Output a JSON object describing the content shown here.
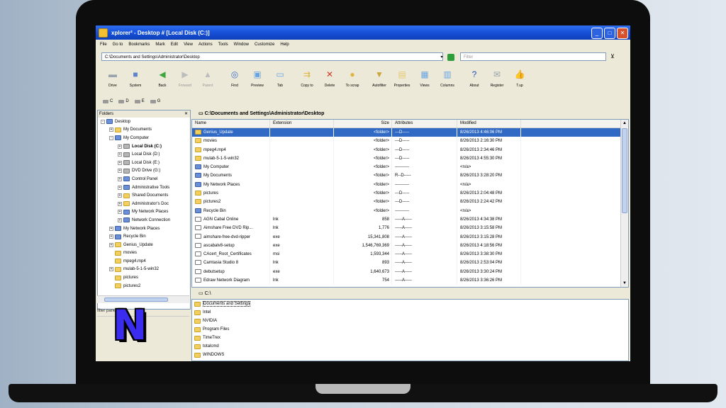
{
  "window": {
    "title": "xplorer² - Desktop # [Local Disk (C:)]",
    "buttons": [
      "_",
      "□",
      "✕"
    ]
  },
  "menu": [
    "File",
    "Go to",
    "Bookmarks",
    "Mark",
    "Edit",
    "View",
    "Actions",
    "Tools",
    "Window",
    "Customize",
    "Help"
  ],
  "address": {
    "value": "C:\\Documents and Settings\\Administrator\\Desktop",
    "filter_placeholder": "Filter"
  },
  "toolbar": [
    {
      "label": "Drive",
      "icon": "drive-icon",
      "glyph": "▬",
      "color": "#9aa3ad",
      "disabled": false
    },
    {
      "label": "System",
      "icon": "system-icon",
      "glyph": "■",
      "color": "#5f83c9",
      "disabled": false
    },
    {
      "sep": true
    },
    {
      "label": "Back",
      "icon": "back-arrow-icon",
      "glyph": "◀",
      "color": "#3fa63f",
      "disabled": false
    },
    {
      "label": "Forward",
      "icon": "forward-arrow-icon",
      "glyph": "▶",
      "color": "#bdbdbd",
      "disabled": true
    },
    {
      "label": "Parent",
      "icon": "parent-folder-icon",
      "glyph": "▲",
      "color": "#bdbdbd",
      "disabled": true
    },
    {
      "sep": true
    },
    {
      "label": "Find",
      "icon": "binoculars-icon",
      "glyph": "◎",
      "color": "#3b6fc9",
      "disabled": false
    },
    {
      "label": "Preview",
      "icon": "preview-icon",
      "glyph": "▣",
      "color": "#6aa4e0",
      "disabled": false
    },
    {
      "label": "Tab",
      "icon": "tab-icon",
      "glyph": "▭",
      "color": "#6aa4e0",
      "disabled": false
    },
    {
      "sep": true
    },
    {
      "label": "Copy to",
      "icon": "copy-to-icon",
      "glyph": "⇉",
      "color": "#e0b53b",
      "disabled": false
    },
    {
      "label": "Delete",
      "icon": "delete-icon",
      "glyph": "✕",
      "color": "#d23a2a",
      "disabled": false
    },
    {
      "label": "To scrap",
      "icon": "scrap-icon",
      "glyph": "●",
      "color": "#e0b53b",
      "disabled": false
    },
    {
      "sep": true
    },
    {
      "label": "Autofilter",
      "icon": "autofilter-icon",
      "glyph": "▼",
      "color": "#c9a53b",
      "disabled": false
    },
    {
      "label": "Properties",
      "icon": "properties-icon",
      "glyph": "▤",
      "color": "#e6c870",
      "disabled": false
    },
    {
      "label": "Views",
      "icon": "views-icon",
      "glyph": "▦",
      "color": "#6aa4e0",
      "disabled": false
    },
    {
      "label": "Columns",
      "icon": "columns-icon",
      "glyph": "▥",
      "color": "#6aa4e0",
      "disabled": false
    },
    {
      "sep": true
    },
    {
      "label": "About",
      "icon": "help-icon",
      "glyph": "?",
      "color": "#1f4fb5",
      "disabled": false
    },
    {
      "label": "Register",
      "icon": "register-icon",
      "glyph": "✉",
      "color": "#9aa3ad",
      "disabled": false
    },
    {
      "label": "T.up",
      "icon": "thumbs-up-icon",
      "glyph": "👍",
      "color": "#e0b53b",
      "disabled": false
    }
  ],
  "drives": [
    "C",
    "D",
    "E",
    "G"
  ],
  "folders_pane": {
    "title": "Folders",
    "tree": [
      {
        "label": "Desktop",
        "indent": 0,
        "exp": "-",
        "type": "sys"
      },
      {
        "label": "My Documents",
        "indent": 1,
        "exp": "+",
        "type": "folder"
      },
      {
        "label": "My Computer",
        "indent": 1,
        "exp": "-",
        "type": "sys"
      },
      {
        "label": "Local Disk (C:)",
        "indent": 2,
        "exp": "+",
        "type": "drive",
        "selected": true
      },
      {
        "label": "Local Disk (D:)",
        "indent": 2,
        "exp": "+",
        "type": "drive"
      },
      {
        "label": "Local Disk (E:)",
        "indent": 2,
        "exp": "+",
        "type": "drive"
      },
      {
        "label": "DVD Drive (G:)",
        "indent": 2,
        "exp": "+",
        "type": "drive"
      },
      {
        "label": "Control Panel",
        "indent": 2,
        "exp": "+",
        "type": "sys"
      },
      {
        "label": "Administrative Tools",
        "indent": 2,
        "exp": "+",
        "type": "sys"
      },
      {
        "label": "Shared Documents",
        "indent": 2,
        "exp": "+",
        "type": "folder"
      },
      {
        "label": "Administrator's Doc",
        "indent": 2,
        "exp": "+",
        "type": "folder"
      },
      {
        "label": "My Network Places",
        "indent": 2,
        "exp": "+",
        "type": "sys"
      },
      {
        "label": "Network Connection",
        "indent": 2,
        "exp": "+",
        "type": "sys"
      },
      {
        "label": "My Network Places",
        "indent": 1,
        "exp": "+",
        "type": "sys"
      },
      {
        "label": "Recycle Bin",
        "indent": 1,
        "exp": "+",
        "type": "sys"
      },
      {
        "label": "Genius_Update",
        "indent": 1,
        "exp": "+",
        "type": "folder"
      },
      {
        "label": "movies",
        "indent": 1,
        "exp": "",
        "type": "folder"
      },
      {
        "label": "mpeg4.mp4",
        "indent": 1,
        "exp": "",
        "type": "folder"
      },
      {
        "label": "mulab-5-1-5-win32",
        "indent": 1,
        "exp": "+",
        "type": "folder"
      },
      {
        "label": "pictures",
        "indent": 1,
        "exp": "",
        "type": "folder"
      },
      {
        "label": "pictures2",
        "indent": 1,
        "exp": "",
        "type": "folder"
      }
    ],
    "lower_label": "filter pane"
  },
  "list": {
    "path": "C:\\Documents and Settings\\Administrator\\Desktop",
    "columns": [
      "Name",
      "Extension",
      "Size",
      "Attributes",
      "Modified"
    ],
    "rows": [
      {
        "name": "Genius_Update",
        "ext": "",
        "size": "<folder>",
        "attr": "---D-----",
        "mod": "8/26/2013 4:46:06 PM",
        "type": "folder",
        "selected": true
      },
      {
        "name": "movies",
        "ext": "",
        "size": "<folder>",
        "attr": "---D-----",
        "mod": "8/26/2013 2:16:30 PM",
        "type": "folder"
      },
      {
        "name": "mpeg4.mp4",
        "ext": "",
        "size": "<folder>",
        "attr": "---D-----",
        "mod": "8/26/2013 2:34:46 PM",
        "type": "folder"
      },
      {
        "name": "mulab-5-1-5-win32",
        "ext": "",
        "size": "<folder>",
        "attr": "---D-----",
        "mod": "8/26/2013 4:55:30 PM",
        "type": "folder"
      },
      {
        "name": "My Computer",
        "ext": "",
        "size": "<folder>",
        "attr": "----------",
        "mod": "<n/a>",
        "type": "sys"
      },
      {
        "name": "My Documents",
        "ext": "",
        "size": "<folder>",
        "attr": "R--D-----",
        "mod": "8/26/2013 3:28:20 PM",
        "type": "sys"
      },
      {
        "name": "My Network Places",
        "ext": "",
        "size": "<folder>",
        "attr": "----------",
        "mod": "<n/a>",
        "type": "sys"
      },
      {
        "name": "pictures",
        "ext": "",
        "size": "<folder>",
        "attr": "---D-----",
        "mod": "8/26/2013 2:04:48 PM",
        "type": "folder"
      },
      {
        "name": "pictures2",
        "ext": "",
        "size": "<folder>",
        "attr": "---D-----",
        "mod": "8/26/2013 2:24:42 PM",
        "type": "folder"
      },
      {
        "name": "Recycle Bin",
        "ext": "",
        "size": "<folder>",
        "attr": "----------",
        "mod": "<n/a>",
        "type": "sys"
      },
      {
        "name": "AGN Cabal Online",
        "ext": "lnk",
        "size": "858",
        "attr": "-----A-----",
        "mod": "8/26/2013 4:34:38 PM",
        "type": "file"
      },
      {
        "name": "Aimshare Free DVD Rip...",
        "ext": "lnk",
        "size": "1,776",
        "attr": "-----A-----",
        "mod": "8/26/2013 3:15:58 PM",
        "type": "file"
      },
      {
        "name": "aimshare-free-dvd-ripper",
        "ext": "exe",
        "size": "15,341,808",
        "attr": "-----A-----",
        "mod": "8/26/2013 3:15:28 PM",
        "type": "file"
      },
      {
        "name": "ascabalv8-setup",
        "ext": "exe",
        "size": "1,546,769,369",
        "attr": "-----A-----",
        "mod": "8/26/2013 4:18:56 PM",
        "type": "file"
      },
      {
        "name": "CAcert_Root_Certificates",
        "ext": "msi",
        "size": "1,593,344",
        "attr": "-----A-----",
        "mod": "8/26/2013 3:38:30 PM",
        "type": "file"
      },
      {
        "name": "Camtasia Studio 8",
        "ext": "lnk",
        "size": "893",
        "attr": "-----A-----",
        "mod": "8/26/2013 2:53:04 PM",
        "type": "file"
      },
      {
        "name": "debutsetup",
        "ext": "exe",
        "size": "1,640,673",
        "attr": "-----A-----",
        "mod": "8/26/2013 3:30:24 PM",
        "type": "file"
      },
      {
        "name": "Edraw Network Diagram",
        "ext": "lnk",
        "size": "754",
        "attr": "-----A-----",
        "mod": "8/26/2013 3:36:26 PM",
        "type": "file"
      }
    ]
  },
  "lower": {
    "path": "C:\\",
    "rows": [
      "Documents and Settings",
      "Intel",
      "NVIDIA",
      "Program Files",
      "TimeTrex",
      "totalcmd",
      "WINDOWS"
    ]
  },
  "logo": {
    "letter": "N",
    "color": "#3b2df0"
  }
}
